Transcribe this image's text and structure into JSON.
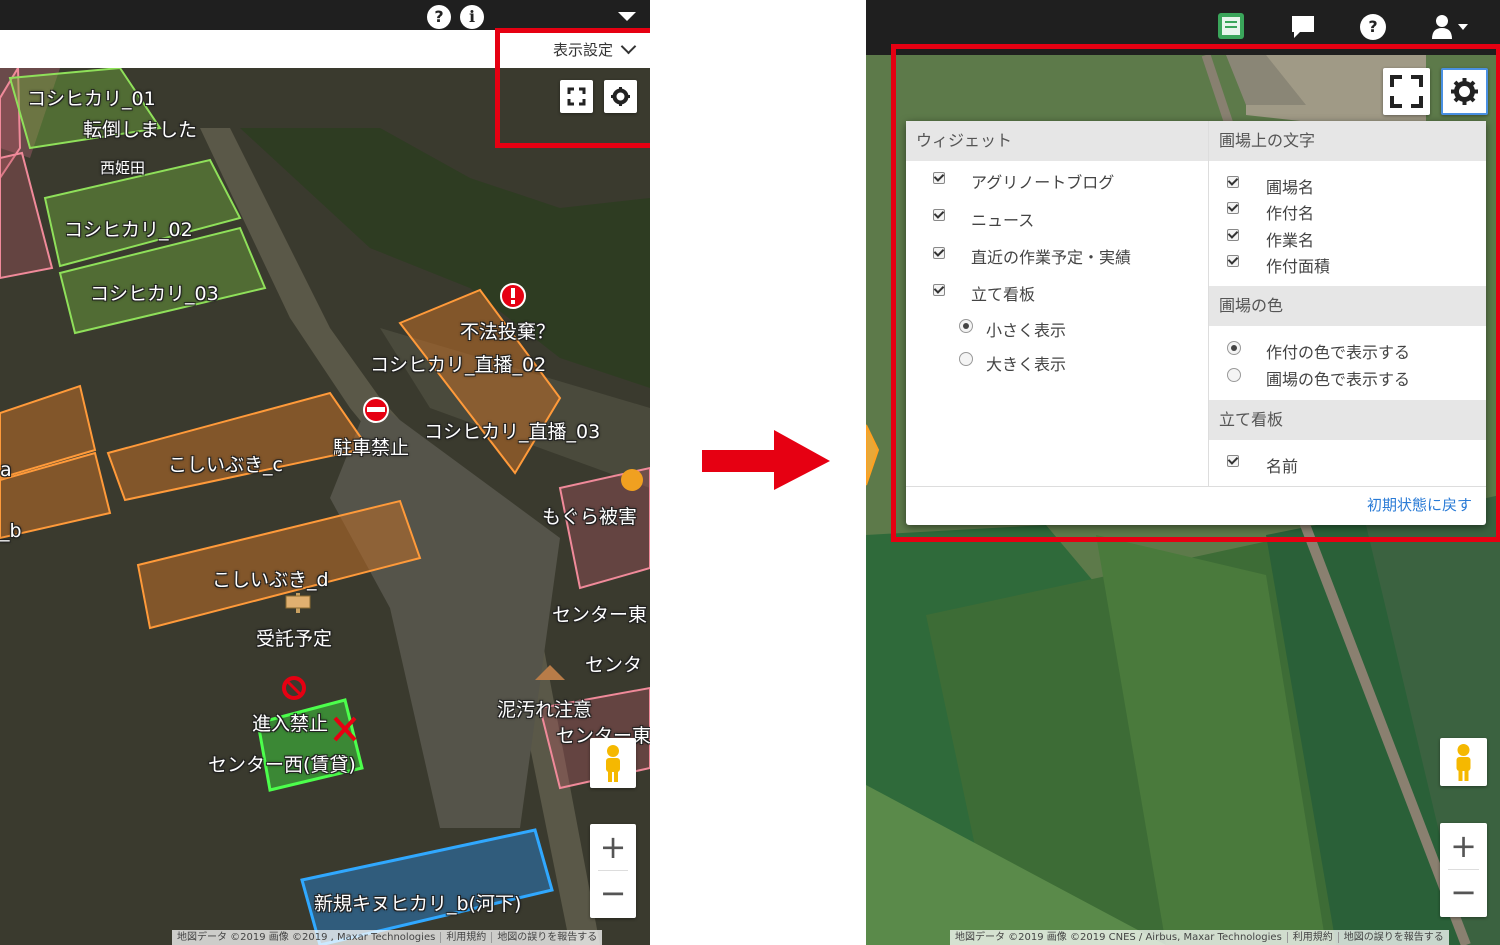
{
  "left": {
    "help_icon": "?",
    "info_icon": "i",
    "display_settings_label": "表示設定",
    "map_labels": [
      "コシヒカリ_01",
      "転倒しました",
      "西姫田",
      "コシヒカリ_02",
      "コシヒカリ_03",
      "不法投棄？",
      "コシヒカリ_直播_02",
      "コシヒカリ_直播_03",
      "駐車禁止",
      "こしいぶき_c",
      "もぐら被害",
      "こしいぶき_d",
      "受託予定",
      "センター東",
      "センタ",
      "泥汚れ注意",
      "センター東",
      "進入禁止",
      "センター西(賃貸)",
      "新規キヌヒカリ_b(河下)",
      "a",
      "_b"
    ],
    "zoom_in": "+",
    "zoom_out": "−",
    "attribution": [
      "地図データ ©2019 画像 ©2019 , Maxar Technologies",
      "利用規約",
      "地図の誤りを報告する"
    ]
  },
  "right": {
    "widget_header": "ウィジェット",
    "widgets": [
      "アグリノートブログ",
      "ニュース",
      "直近の作業予定・実績",
      "立て看板"
    ],
    "signboard_sizes": [
      "小さく表示",
      "大きく表示"
    ],
    "signboard_selected": "小さく表示",
    "field_text_header": "圃場上の文字",
    "field_text_options": [
      "圃場名",
      "作付名",
      "作業名",
      "作付面積"
    ],
    "field_color_header": "圃場の色",
    "field_color_options": [
      "作付の色で表示する",
      "圃場の色で表示する"
    ],
    "field_color_selected": "作付の色で表示する",
    "signboard_header": "立て看板",
    "signboard_options": [
      "名前"
    ],
    "reset_label": "初期状態に戻す",
    "zoom_in": "+",
    "zoom_out": "−",
    "attribution": [
      "地図データ ©2019 画像 ©2019 CNES / Airbus, Maxar Technologies",
      "利用規約",
      "地図の誤りを報告する"
    ]
  },
  "colors": {
    "highlight": "#e60012",
    "link": "#2a7bd6",
    "topbar": "#1f1f1f"
  }
}
